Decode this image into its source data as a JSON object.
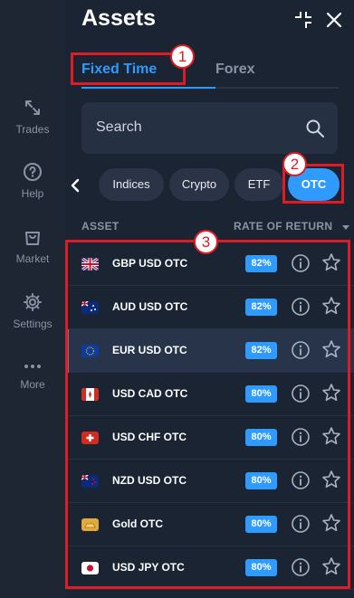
{
  "sidebar": {
    "items": [
      {
        "label": "Trades",
        "icon": "trades-icon"
      },
      {
        "label": "Help",
        "icon": "help-icon"
      },
      {
        "label": "Market",
        "icon": "market-icon"
      },
      {
        "label": "Settings",
        "icon": "settings-icon"
      },
      {
        "label": "More",
        "icon": "more-icon"
      }
    ]
  },
  "panel": {
    "title": "Assets",
    "tabs": [
      {
        "label": "Fixed Time",
        "active": true
      },
      {
        "label": "Forex",
        "active": false
      }
    ],
    "search": {
      "placeholder": "Search"
    },
    "filters": [
      {
        "label": "Indices",
        "active": false
      },
      {
        "label": "Crypto",
        "active": false
      },
      {
        "label": "ETF",
        "active": false
      },
      {
        "label": "OTC",
        "active": true
      }
    ],
    "columns": {
      "asset": "ASSET",
      "rate": "RATE OF RETURN"
    },
    "assets": [
      {
        "name": "GBP USD OTC",
        "rate": "82%",
        "flag": "gb-us",
        "selected": false
      },
      {
        "name": "AUD USD OTC",
        "rate": "82%",
        "flag": "au-us",
        "selected": false
      },
      {
        "name": "EUR USD OTC",
        "rate": "82%",
        "flag": "eu-us",
        "selected": true
      },
      {
        "name": "USD CAD OTC",
        "rate": "80%",
        "flag": "us-ca",
        "selected": false
      },
      {
        "name": "USD CHF OTC",
        "rate": "80%",
        "flag": "us-ch",
        "selected": false
      },
      {
        "name": "NZD USD OTC",
        "rate": "80%",
        "flag": "nz-us",
        "selected": false
      },
      {
        "name": "Gold OTC",
        "rate": "80%",
        "flag": "gold",
        "selected": false
      },
      {
        "name": "USD JPY OTC",
        "rate": "80%",
        "flag": "us-jp",
        "selected": false
      }
    ]
  },
  "annotations": [
    "1",
    "2",
    "3"
  ],
  "colors": {
    "accent": "#2f9bff",
    "annotation": "#e01b24",
    "background": "#1b2432"
  }
}
